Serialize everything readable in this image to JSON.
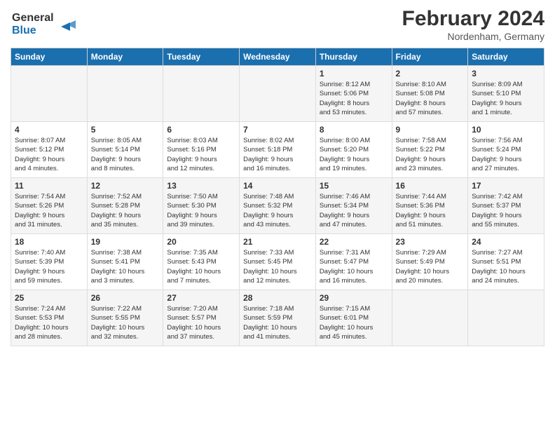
{
  "header": {
    "logo_line1": "General",
    "logo_line2": "Blue",
    "title": "February 2024",
    "subtitle": "Nordenham, Germany"
  },
  "days_of_week": [
    "Sunday",
    "Monday",
    "Tuesday",
    "Wednesday",
    "Thursday",
    "Friday",
    "Saturday"
  ],
  "weeks": [
    [
      {
        "day": "",
        "info": ""
      },
      {
        "day": "",
        "info": ""
      },
      {
        "day": "",
        "info": ""
      },
      {
        "day": "",
        "info": ""
      },
      {
        "day": "1",
        "info": "Sunrise: 8:12 AM\nSunset: 5:06 PM\nDaylight: 8 hours\nand 53 minutes."
      },
      {
        "day": "2",
        "info": "Sunrise: 8:10 AM\nSunset: 5:08 PM\nDaylight: 8 hours\nand 57 minutes."
      },
      {
        "day": "3",
        "info": "Sunrise: 8:09 AM\nSunset: 5:10 PM\nDaylight: 9 hours\nand 1 minute."
      }
    ],
    [
      {
        "day": "4",
        "info": "Sunrise: 8:07 AM\nSunset: 5:12 PM\nDaylight: 9 hours\nand 4 minutes."
      },
      {
        "day": "5",
        "info": "Sunrise: 8:05 AM\nSunset: 5:14 PM\nDaylight: 9 hours\nand 8 minutes."
      },
      {
        "day": "6",
        "info": "Sunrise: 8:03 AM\nSunset: 5:16 PM\nDaylight: 9 hours\nand 12 minutes."
      },
      {
        "day": "7",
        "info": "Sunrise: 8:02 AM\nSunset: 5:18 PM\nDaylight: 9 hours\nand 16 minutes."
      },
      {
        "day": "8",
        "info": "Sunrise: 8:00 AM\nSunset: 5:20 PM\nDaylight: 9 hours\nand 19 minutes."
      },
      {
        "day": "9",
        "info": "Sunrise: 7:58 AM\nSunset: 5:22 PM\nDaylight: 9 hours\nand 23 minutes."
      },
      {
        "day": "10",
        "info": "Sunrise: 7:56 AM\nSunset: 5:24 PM\nDaylight: 9 hours\nand 27 minutes."
      }
    ],
    [
      {
        "day": "11",
        "info": "Sunrise: 7:54 AM\nSunset: 5:26 PM\nDaylight: 9 hours\nand 31 minutes."
      },
      {
        "day": "12",
        "info": "Sunrise: 7:52 AM\nSunset: 5:28 PM\nDaylight: 9 hours\nand 35 minutes."
      },
      {
        "day": "13",
        "info": "Sunrise: 7:50 AM\nSunset: 5:30 PM\nDaylight: 9 hours\nand 39 minutes."
      },
      {
        "day": "14",
        "info": "Sunrise: 7:48 AM\nSunset: 5:32 PM\nDaylight: 9 hours\nand 43 minutes."
      },
      {
        "day": "15",
        "info": "Sunrise: 7:46 AM\nSunset: 5:34 PM\nDaylight: 9 hours\nand 47 minutes."
      },
      {
        "day": "16",
        "info": "Sunrise: 7:44 AM\nSunset: 5:36 PM\nDaylight: 9 hours\nand 51 minutes."
      },
      {
        "day": "17",
        "info": "Sunrise: 7:42 AM\nSunset: 5:37 PM\nDaylight: 9 hours\nand 55 minutes."
      }
    ],
    [
      {
        "day": "18",
        "info": "Sunrise: 7:40 AM\nSunset: 5:39 PM\nDaylight: 9 hours\nand 59 minutes."
      },
      {
        "day": "19",
        "info": "Sunrise: 7:38 AM\nSunset: 5:41 PM\nDaylight: 10 hours\nand 3 minutes."
      },
      {
        "day": "20",
        "info": "Sunrise: 7:35 AM\nSunset: 5:43 PM\nDaylight: 10 hours\nand 7 minutes."
      },
      {
        "day": "21",
        "info": "Sunrise: 7:33 AM\nSunset: 5:45 PM\nDaylight: 10 hours\nand 12 minutes."
      },
      {
        "day": "22",
        "info": "Sunrise: 7:31 AM\nSunset: 5:47 PM\nDaylight: 10 hours\nand 16 minutes."
      },
      {
        "day": "23",
        "info": "Sunrise: 7:29 AM\nSunset: 5:49 PM\nDaylight: 10 hours\nand 20 minutes."
      },
      {
        "day": "24",
        "info": "Sunrise: 7:27 AM\nSunset: 5:51 PM\nDaylight: 10 hours\nand 24 minutes."
      }
    ],
    [
      {
        "day": "25",
        "info": "Sunrise: 7:24 AM\nSunset: 5:53 PM\nDaylight: 10 hours\nand 28 minutes."
      },
      {
        "day": "26",
        "info": "Sunrise: 7:22 AM\nSunset: 5:55 PM\nDaylight: 10 hours\nand 32 minutes."
      },
      {
        "day": "27",
        "info": "Sunrise: 7:20 AM\nSunset: 5:57 PM\nDaylight: 10 hours\nand 37 minutes."
      },
      {
        "day": "28",
        "info": "Sunrise: 7:18 AM\nSunset: 5:59 PM\nDaylight: 10 hours\nand 41 minutes."
      },
      {
        "day": "29",
        "info": "Sunrise: 7:15 AM\nSunset: 6:01 PM\nDaylight: 10 hours\nand 45 minutes."
      },
      {
        "day": "",
        "info": ""
      },
      {
        "day": "",
        "info": ""
      }
    ]
  ]
}
